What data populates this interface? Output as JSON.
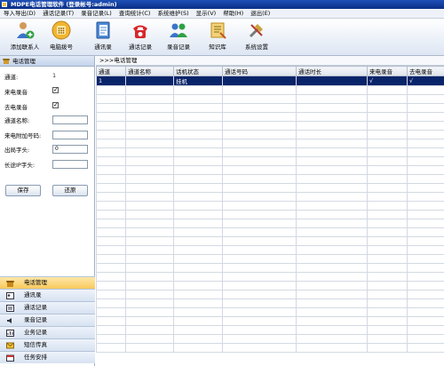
{
  "window": {
    "title": "MDPE电话管理软件 (登录帐号:admin)"
  },
  "menu": [
    "导入导出(D)",
    "通话记录(T)",
    "录音记录(L)",
    "查询统计(C)",
    "系统维护(S)",
    "显示(V)",
    "帮助(H)",
    "退出(E)"
  ],
  "toolbar": {
    "buttons": [
      {
        "label": "添加联系人",
        "icon": "add-contact-icon"
      },
      {
        "label": "电脑拨号",
        "icon": "phone-dial-icon"
      },
      {
        "label": "通讯录",
        "icon": "address-book-icon"
      },
      {
        "label": "通话记录",
        "icon": "call-record-icon"
      },
      {
        "label": "录音记录",
        "icon": "recording-icon"
      },
      {
        "label": "知识库",
        "icon": "knowledge-base-icon"
      },
      {
        "label": "系统设置",
        "icon": "settings-icon"
      }
    ]
  },
  "leftpane": {
    "header": "电话管理",
    "channel_label": "通道:",
    "channel_value": "1",
    "incoming_rec_label": "来电录音",
    "outgoing_rec_label": "去电录音",
    "channel_name_label": "通道名称:",
    "caller_extra_label": "来电附加号码:",
    "outside_prefix_label": "出局字头:",
    "outside_prefix_value": "0",
    "long_ip_label": "长途IP字头:",
    "save_label": "保存",
    "restore_label": "还原"
  },
  "nav": [
    {
      "label": "电话管理",
      "active": true
    },
    {
      "label": "通讯录"
    },
    {
      "label": "通话记录"
    },
    {
      "label": "录音记录"
    },
    {
      "label": "业务记录"
    },
    {
      "label": "短信传真"
    },
    {
      "label": "任务安排"
    }
  ],
  "main": {
    "breadcrumb": ">>>电话管理",
    "columns": [
      "通道",
      "通道名称",
      "话机状态",
      "通话号码",
      "通话时长",
      "来电录音",
      "去电录音"
    ],
    "rows": [
      [
        "1",
        "",
        "挂机",
        "",
        "",
        "√",
        "√"
      ]
    ]
  },
  "colors": {
    "accent": "#0a246a",
    "titlebar": "#1e4fb8",
    "nav_active": "#f8c95c"
  }
}
